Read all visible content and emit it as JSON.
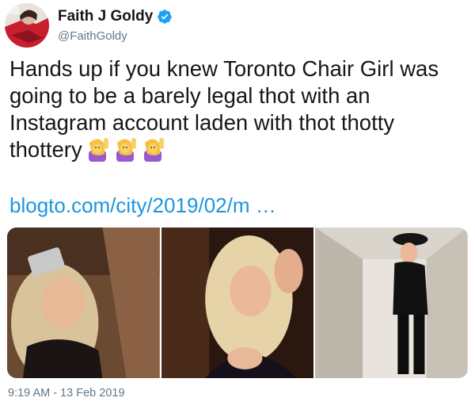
{
  "author": {
    "display_name": "Faith J Goldy",
    "handle": "@FaithGoldy",
    "verified": true
  },
  "tweet": {
    "lines": [
      "Hands up if you knew Toronto Chair Girl was",
      "going to be a barely legal thot with an",
      "Instagram account laden with thot thotty",
      "thottery"
    ],
    "emojis": [
      "person-raising-hand-emoji",
      "person-raising-hand-emoji",
      "person-raising-hand-emoji"
    ],
    "link_text": "blogto.com/city/2019/02/m …",
    "timestamp": "9:19 AM - 13 Feb 2019"
  },
  "media": {
    "photos": [
      {
        "name": "photo-1"
      },
      {
        "name": "photo-2"
      },
      {
        "name": "photo-3"
      }
    ]
  },
  "colors": {
    "text": "#14171a",
    "secondary": "#657786",
    "link": "#1b95e0",
    "verified": "#1da1f2"
  }
}
